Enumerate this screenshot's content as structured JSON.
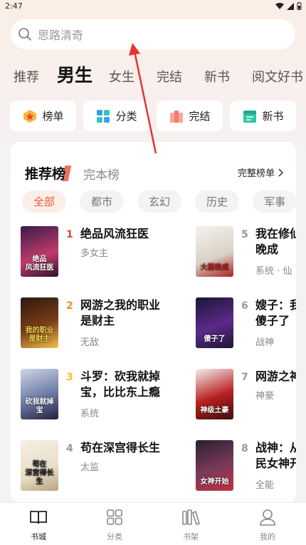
{
  "status": {
    "time": "2:47"
  },
  "search": {
    "placeholder": "思路清奇"
  },
  "tabs": [
    "推荐",
    "男生",
    "女生",
    "完结",
    "新书",
    "阅文好书"
  ],
  "quick": [
    {
      "label": "榜单",
      "icon": "star-badge-icon"
    },
    {
      "label": "分类",
      "icon": "grid-icon"
    },
    {
      "label": "完结",
      "icon": "books-icon"
    },
    {
      "label": "新书",
      "icon": "new-book-icon"
    }
  ],
  "ranking": {
    "active_tab": "推荐榜",
    "other_tab": "完本榜",
    "full_list": "完整榜单",
    "chips": [
      "全部",
      "都市",
      "玄幻",
      "历史",
      "军事"
    ]
  },
  "books_left": [
    {
      "rank": "1",
      "title_lines": [
        "绝品风流狂医"
      ],
      "tag": "多女主",
      "cover_text": "绝品\n风流狂医",
      "rank_color": "#e8413a"
    },
    {
      "rank": "2",
      "title_lines": [
        "网游之我的职业",
        "是财主"
      ],
      "tag": "无敌",
      "cover_text": "我的职业\n是财主",
      "rank_color": "#f08a2c"
    },
    {
      "rank": "3",
      "title_lines": [
        "斗罗：砍我就掉",
        "宝，比比东上瘾"
      ],
      "tag": "系统",
      "cover_text": "砍我就掉宝",
      "rank_color": "#f4c02a"
    },
    {
      "rank": "4",
      "title_lines": [
        "苟在深宫得长生"
      ],
      "tag": "太监",
      "cover_text": "苟在\n深宫得长生",
      "rank_color": "#999999"
    }
  ],
  "books_right": [
    {
      "rank": "5",
      "title_lines": [
        "我在修仙",
        "晚成"
      ],
      "tag": "系统 · 仙",
      "cover_text": "大器晚成",
      "rank_color": "#999999"
    },
    {
      "rank": "6",
      "title_lines": [
        "嫂子：我",
        "傻子了"
      ],
      "tag": "战神",
      "cover_text": "傻子了",
      "rank_color": "#999999"
    },
    {
      "rank": "7",
      "title_lines": [
        "网游之神"
      ],
      "tag": "神豪",
      "cover_text": "神级土豪",
      "rank_color": "#999999"
    },
    {
      "rank": "8",
      "title_lines": [
        "战神：从",
        "民女神开"
      ],
      "tag": "全能",
      "cover_text": "女神开始",
      "rank_color": "#999999"
    }
  ],
  "nav": [
    {
      "label": "书城",
      "icon": "book-open-icon"
    },
    {
      "label": "分类",
      "icon": "grid-icon"
    },
    {
      "label": "书架",
      "icon": "bookshelf-icon"
    },
    {
      "label": "我的",
      "icon": "user-icon"
    }
  ],
  "colors": {
    "accent": "#e75a35",
    "arrow": "#e8332f"
  }
}
